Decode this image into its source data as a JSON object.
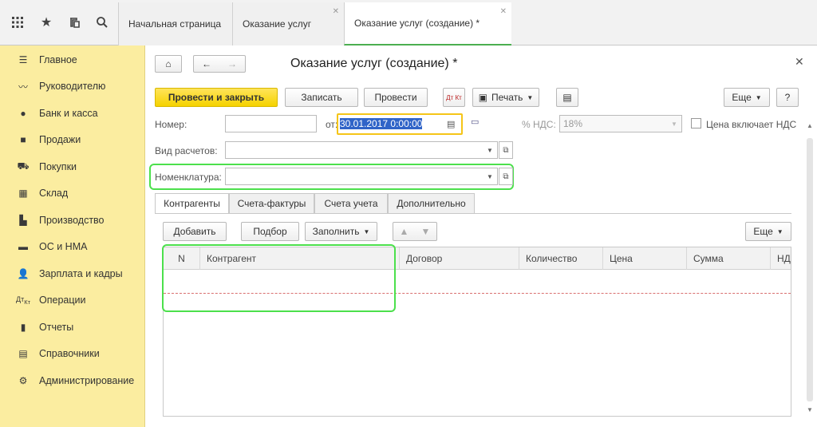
{
  "topbar": {
    "icons": [
      "apps-grid-icon",
      "star-icon",
      "history-icon",
      "search-icon"
    ],
    "tabs": [
      {
        "label": "Начальная страница",
        "closable": false,
        "active": false
      },
      {
        "label": "Оказание услуг",
        "closable": true,
        "active": false
      },
      {
        "label": "Оказание услуг (создание) *",
        "closable": true,
        "active": true
      }
    ]
  },
  "sidebar": {
    "items": [
      {
        "label": "Главное",
        "icon": "menu-icon"
      },
      {
        "label": "Руководителю",
        "icon": "trend-icon"
      },
      {
        "label": "Банк и касса",
        "icon": "ruble-icon"
      },
      {
        "label": "Продажи",
        "icon": "bag-icon"
      },
      {
        "label": "Покупки",
        "icon": "cart-icon"
      },
      {
        "label": "Склад",
        "icon": "warehouse-icon"
      },
      {
        "label": "Производство",
        "icon": "factory-icon"
      },
      {
        "label": "ОС и НМА",
        "icon": "truck-icon"
      },
      {
        "label": "Зарплата и кадры",
        "icon": "person-icon"
      },
      {
        "label": "Операции",
        "icon": "dtkt-icon"
      },
      {
        "label": "Отчеты",
        "icon": "bars-icon"
      },
      {
        "label": "Справочники",
        "icon": "book-icon"
      },
      {
        "label": "Администрирование",
        "icon": "gear-icon"
      }
    ]
  },
  "form": {
    "title": "Оказание услуг (создание) *",
    "toolbar": {
      "post_close": "Провести и закрыть",
      "save": "Записать",
      "post": "Провести",
      "dtkt": "Дт Кт",
      "print": "Печать",
      "more": "Еще",
      "help": "?"
    },
    "fields": {
      "number_label": "Номер:",
      "number_value": "",
      "date_label": "от:",
      "date_value": "30.01.2017  0:00:00",
      "vat_label": "% НДС:",
      "vat_value": "18%",
      "price_incl_vat_label": "Цена включает НДС",
      "settlement_label": "Вид расчетов:",
      "settlement_value": "",
      "nomenclature_label": "Номенклатура:",
      "nomenclature_value": ""
    },
    "tabs": [
      "Контрагенты",
      "Счета-фактуры",
      "Счета учета",
      "Дополнительно"
    ],
    "table_toolbar": {
      "add": "Добавить",
      "pick": "Подбор",
      "fill": "Заполнить",
      "more": "Еще"
    },
    "table": {
      "columns": [
        "N",
        "Контрагент",
        "Договор",
        "Количество",
        "Цена",
        "Сумма",
        "НД"
      ],
      "rows": []
    }
  }
}
